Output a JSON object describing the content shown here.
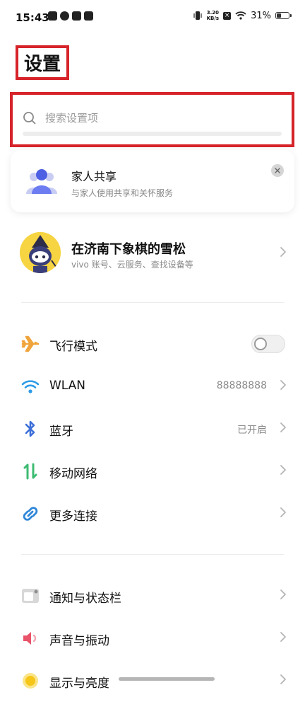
{
  "status_bar": {
    "time": "15:43",
    "speed_value": "3.20",
    "speed_unit": "KB/s",
    "battery": "31%",
    "battery_level": 31
  },
  "header": {
    "title": "设置"
  },
  "search": {
    "placeholder": "搜索设置项"
  },
  "family_card": {
    "title": "家人共享",
    "subtitle": "与家人使用共享和关怀服务"
  },
  "account": {
    "name": "在济南下象棋的雪松",
    "subtitle": "vivo 账号、云服务、查找设备等"
  },
  "settings_group_1": [
    {
      "label": "飞行模式",
      "icon": "airplane-icon",
      "type": "toggle",
      "on": false
    },
    {
      "label": "WLAN",
      "icon": "wifi-icon",
      "value": "88888888"
    },
    {
      "label": "蓝牙",
      "icon": "bluetooth-icon",
      "value": "已开启"
    },
    {
      "label": "移动网络",
      "icon": "mobile-data-icon",
      "value": ""
    },
    {
      "label": "更多连接",
      "icon": "link-icon",
      "value": ""
    }
  ],
  "settings_group_2": [
    {
      "label": "通知与状态栏",
      "icon": "notification-icon"
    },
    {
      "label": "声音与振动",
      "icon": "speaker-icon"
    },
    {
      "label": "显示与亮度",
      "icon": "brightness-icon"
    }
  ],
  "colors": {
    "highlight": "#d6242a",
    "airplane": "#f0a43c",
    "wifi": "#2e9be6",
    "bluetooth": "#3d6fd8",
    "mobile": "#3dbb72",
    "link": "#2e86d8",
    "speaker": "#e9546b",
    "brightness": "#f5c518"
  }
}
